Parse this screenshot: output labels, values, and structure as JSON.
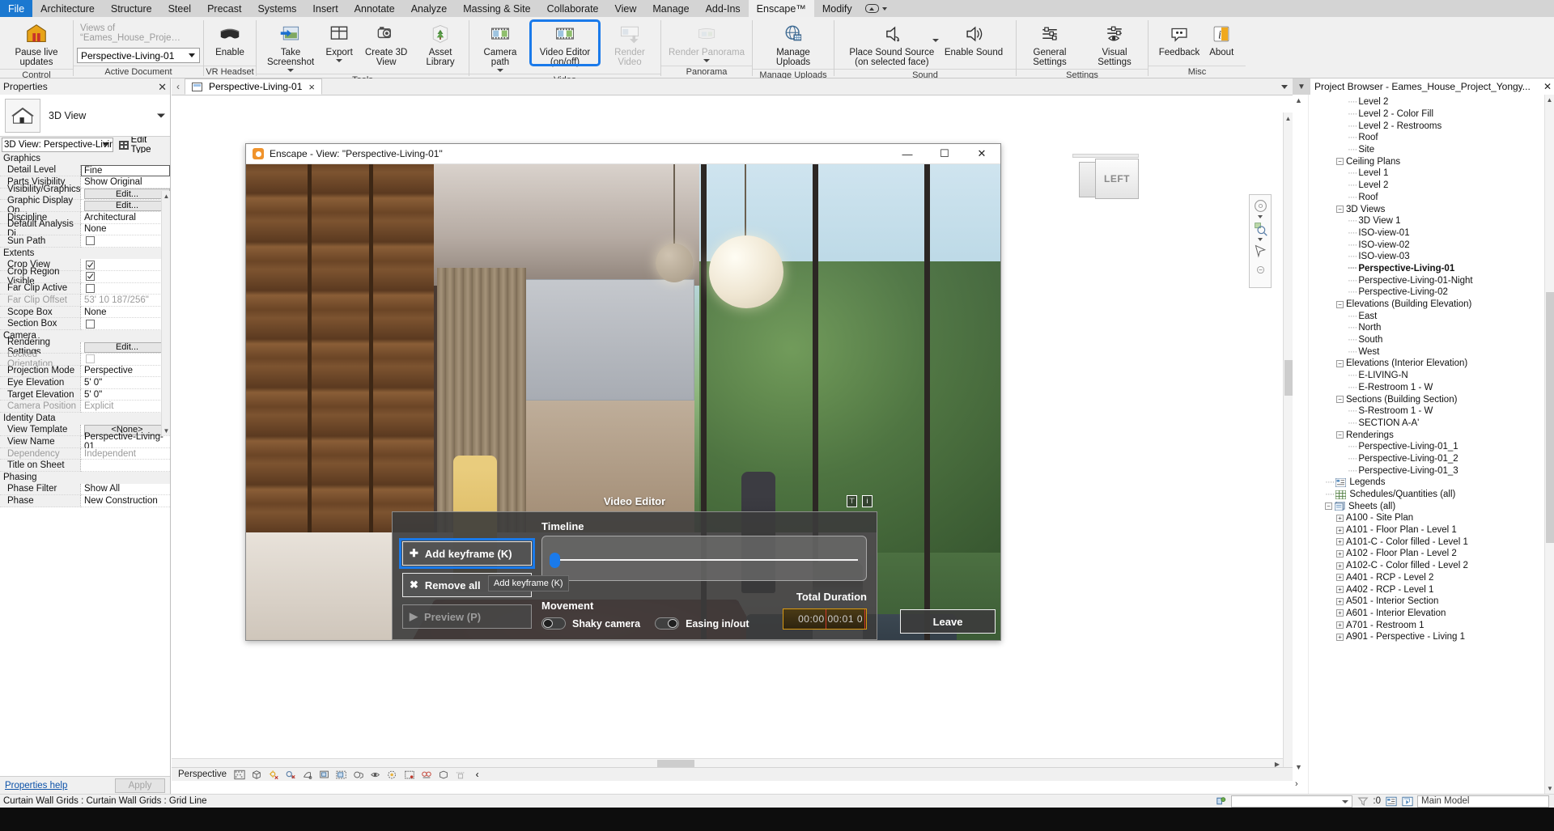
{
  "menu": {
    "file_label": "File",
    "items": [
      "Architecture",
      "Structure",
      "Steel",
      "Precast",
      "Systems",
      "Insert",
      "Annotate",
      "Analyze",
      "Massing & Site",
      "Collaborate",
      "View",
      "Manage",
      "Add-Ins",
      "Enscape™",
      "Modify"
    ],
    "active": "Enscape™"
  },
  "ribbon": {
    "groups": [
      {
        "label": "Control",
        "buttons": [
          {
            "label": "Pause live updates",
            "icon": "pause-live-updates-icon",
            "enabled": true
          }
        ]
      },
      {
        "label": "Active Document",
        "buttons": []
      },
      {
        "label": "VR Headset",
        "buttons": [
          {
            "label": "Enable",
            "icon": "vr-headset-icon",
            "enabled": true
          }
        ]
      },
      {
        "label": "Tools",
        "buttons": [
          {
            "label": "Take Screenshot",
            "icon": "take-screenshot-icon",
            "enabled": true,
            "dropdown": true
          },
          {
            "label": "Export",
            "icon": "export-icon",
            "enabled": true,
            "dropdown": true
          },
          {
            "label": "Create 3D View",
            "icon": "create-3d-view-icon",
            "enabled": true
          },
          {
            "label": "Asset Library",
            "icon": "asset-library-icon",
            "enabled": true
          }
        ]
      },
      {
        "label": "Video",
        "buttons": [
          {
            "label": "Camera path",
            "icon": "camera-path-icon",
            "enabled": true,
            "dropdown": true
          },
          {
            "label": "Video Editor (on/off)",
            "icon": "video-editor-icon",
            "enabled": true,
            "highlighted": true
          },
          {
            "label": "Render Video",
            "icon": "render-video-icon",
            "enabled": false
          }
        ]
      },
      {
        "label": "Panorama",
        "buttons": [
          {
            "label": "Render Panorama",
            "icon": "render-panorama-icon",
            "enabled": false,
            "dropdown": true
          }
        ]
      },
      {
        "label": "Manage Uploads",
        "buttons": [
          {
            "label": "Manage Uploads",
            "icon": "manage-uploads-icon",
            "enabled": true
          }
        ]
      },
      {
        "label": "Sound",
        "buttons": [
          {
            "label": "Place Sound Source\n(on selected face)",
            "icon": "place-sound-source-icon",
            "enabled": true,
            "dropdown": true
          },
          {
            "label": "Enable Sound",
            "icon": "enable-sound-icon",
            "enabled": true
          }
        ]
      },
      {
        "label": "Settings",
        "buttons": [
          {
            "label": "General Settings",
            "icon": "general-settings-icon",
            "enabled": true
          },
          {
            "label": "Visual Settings",
            "icon": "visual-settings-icon",
            "enabled": true
          }
        ]
      },
      {
        "label": "Misc",
        "buttons": [
          {
            "label": "Feedback",
            "icon": "feedback-icon",
            "enabled": true
          },
          {
            "label": "About",
            "icon": "about-icon",
            "enabled": true
          }
        ]
      }
    ],
    "active_document": {
      "caption": "Views of “Eames_House_Proje…",
      "value": "Perspective-Living-01"
    }
  },
  "properties": {
    "title": "Properties",
    "thumb_label": "3D View",
    "type_selector": "3D View: Perspective-Living·",
    "edit_type_label": "Edit Type",
    "sections": [
      {
        "name": "Graphics",
        "rows": [
          {
            "key": "Detail Level",
            "value": "Fine",
            "kind": "text",
            "selected": true
          },
          {
            "key": "Parts Visibility",
            "value": "Show Original",
            "kind": "text"
          },
          {
            "key": "Visibility/Graphics ...",
            "value": "Edit...",
            "kind": "button"
          },
          {
            "key": "Graphic Display Op...",
            "value": "Edit...",
            "kind": "button"
          },
          {
            "key": "Discipline",
            "value": "Architectural",
            "kind": "text"
          },
          {
            "key": "Default Analysis Di...",
            "value": "None",
            "kind": "text"
          },
          {
            "key": "Sun Path",
            "value": "",
            "kind": "checkbox",
            "checked": false
          }
        ]
      },
      {
        "name": "Extents",
        "rows": [
          {
            "key": "Crop View",
            "value": "",
            "kind": "checkbox",
            "checked": true
          },
          {
            "key": "Crop Region Visible",
            "value": "",
            "kind": "checkbox",
            "checked": true
          },
          {
            "key": "Far Clip Active",
            "value": "",
            "kind": "checkbox",
            "checked": false
          },
          {
            "key": "Far Clip Offset",
            "value": "53'  10 187/256\"",
            "kind": "text",
            "dim": true
          },
          {
            "key": "Scope Box",
            "value": "None",
            "kind": "text"
          },
          {
            "key": "Section Box",
            "value": "",
            "kind": "checkbox",
            "checked": false
          }
        ]
      },
      {
        "name": "Camera",
        "rows": [
          {
            "key": "Rendering Settings",
            "value": "Edit...",
            "kind": "button"
          },
          {
            "key": "Locked Orientation",
            "value": "",
            "kind": "checkbox",
            "checked": false,
            "dim": true
          },
          {
            "key": "Projection Mode",
            "value": "Perspective",
            "kind": "text"
          },
          {
            "key": "Eye Elevation",
            "value": "5'  0\"",
            "kind": "text"
          },
          {
            "key": "Target Elevation",
            "value": "5'  0\"",
            "kind": "text"
          },
          {
            "key": "Camera Position",
            "value": "Explicit",
            "kind": "text",
            "dim": true
          }
        ]
      },
      {
        "name": "Identity Data",
        "rows": [
          {
            "key": "View Template",
            "value": "<None>",
            "kind": "button"
          },
          {
            "key": "View Name",
            "value": "Perspective-Living-01",
            "kind": "text"
          },
          {
            "key": "Dependency",
            "value": "Independent",
            "kind": "text",
            "dim": true
          },
          {
            "key": "Title on Sheet",
            "value": "",
            "kind": "text"
          }
        ]
      },
      {
        "name": "Phasing",
        "rows": [
          {
            "key": "Phase Filter",
            "value": "Show All",
            "kind": "text"
          },
          {
            "key": "Phase",
            "value": "New Construction",
            "kind": "text"
          }
        ]
      }
    ],
    "help_link": "Properties help",
    "apply_label": "Apply"
  },
  "document_tab": {
    "label": "Perspective-Living-01",
    "close": "×"
  },
  "viewcube": {
    "face_left": "LEFT"
  },
  "enscape_window": {
    "title": "Enscape - View: \"Perspective-Living-01\"",
    "minimize": "—",
    "maximize": "☐",
    "close": "✕"
  },
  "video_editor": {
    "title": "Video Editor",
    "pin_icon": "pin-icon",
    "info_icon": "info-icon",
    "add_keyframe_label": "Add keyframe (K)",
    "remove_all_label": "Remove all",
    "preview_label": "Preview (P)",
    "timeline_label": "Timeline",
    "movement_label": "Movement",
    "shaky_camera_label": "Shaky camera",
    "shaky_camera_state": "off",
    "easing_label": "Easing in/out",
    "easing_state": "on",
    "total_duration_label": "Total Duration",
    "total_duration_value": "00:00 00:01 0",
    "tooltip": "Add keyframe (K)",
    "leave_label": "Leave",
    "accent_color": "#1a7aea"
  },
  "project_browser": {
    "title": "Project Browser - Eames_House_Project_Yongy...",
    "close": "✕",
    "nodes": [
      {
        "label": "Level 2",
        "depth": 3,
        "toggle": null,
        "icon": null
      },
      {
        "label": "Level 2 - Color Fill",
        "depth": 3,
        "toggle": null,
        "icon": null
      },
      {
        "label": "Level 2 - Restrooms",
        "depth": 3,
        "toggle": null,
        "icon": null
      },
      {
        "label": "Roof",
        "depth": 3,
        "toggle": null,
        "icon": null
      },
      {
        "label": "Site",
        "depth": 3,
        "toggle": null,
        "icon": null
      },
      {
        "label": "Ceiling Plans",
        "depth": 2,
        "toggle": "minus",
        "icon": null
      },
      {
        "label": "Level 1",
        "depth": 3,
        "toggle": null,
        "icon": null
      },
      {
        "label": "Level 2",
        "depth": 3,
        "toggle": null,
        "icon": null
      },
      {
        "label": "Roof",
        "depth": 3,
        "toggle": null,
        "icon": null
      },
      {
        "label": "3D Views",
        "depth": 2,
        "toggle": "minus",
        "icon": null
      },
      {
        "label": "3D View 1",
        "depth": 3,
        "toggle": null,
        "icon": null
      },
      {
        "label": "ISO-view-01",
        "depth": 3,
        "toggle": null,
        "icon": null
      },
      {
        "label": "ISO-view-02",
        "depth": 3,
        "toggle": null,
        "icon": null
      },
      {
        "label": "ISO-view-03",
        "depth": 3,
        "toggle": null,
        "icon": null
      },
      {
        "label": "Perspective-Living-01",
        "depth": 3,
        "toggle": null,
        "icon": null,
        "bold": true
      },
      {
        "label": "Perspective-Living-01-Night",
        "depth": 3,
        "toggle": null,
        "icon": null
      },
      {
        "label": "Perspective-Living-02",
        "depth": 3,
        "toggle": null,
        "icon": null
      },
      {
        "label": "Elevations (Building Elevation)",
        "depth": 2,
        "toggle": "minus",
        "icon": null
      },
      {
        "label": "East",
        "depth": 3,
        "toggle": null,
        "icon": null
      },
      {
        "label": "North",
        "depth": 3,
        "toggle": null,
        "icon": null
      },
      {
        "label": "South",
        "depth": 3,
        "toggle": null,
        "icon": null
      },
      {
        "label": "West",
        "depth": 3,
        "toggle": null,
        "icon": null
      },
      {
        "label": "Elevations (Interior Elevation)",
        "depth": 2,
        "toggle": "minus",
        "icon": null
      },
      {
        "label": "E-LIVING-N",
        "depth": 3,
        "toggle": null,
        "icon": null
      },
      {
        "label": "E-Restroom 1 - W",
        "depth": 3,
        "toggle": null,
        "icon": null
      },
      {
        "label": "Sections (Building Section)",
        "depth": 2,
        "toggle": "minus",
        "icon": null
      },
      {
        "label": "S-Restroom 1 - W",
        "depth": 3,
        "toggle": null,
        "icon": null
      },
      {
        "label": "SECTION A-A'",
        "depth": 3,
        "toggle": null,
        "icon": null
      },
      {
        "label": "Renderings",
        "depth": 2,
        "toggle": "minus",
        "icon": null
      },
      {
        "label": "Perspective-Living-01_1",
        "depth": 3,
        "toggle": null,
        "icon": null
      },
      {
        "label": "Perspective-Living-01_2",
        "depth": 3,
        "toggle": null,
        "icon": null
      },
      {
        "label": "Perspective-Living-01_3",
        "depth": 3,
        "toggle": null,
        "icon": null
      },
      {
        "label": "Legends",
        "depth": 1,
        "toggle": null,
        "icon": "legend-icon"
      },
      {
        "label": "Schedules/Quantities (all)",
        "depth": 1,
        "toggle": null,
        "icon": "schedule-icon"
      },
      {
        "label": "Sheets (all)",
        "depth": 1,
        "toggle": "minus",
        "icon": "sheets-icon"
      },
      {
        "label": "A100 - Site Plan",
        "depth": 2,
        "toggle": "plus",
        "icon": null
      },
      {
        "label": "A101 - Floor Plan - Level 1",
        "depth": 2,
        "toggle": "plus",
        "icon": null
      },
      {
        "label": "A101-C - Color filled - Level 1",
        "depth": 2,
        "toggle": "plus",
        "icon": null
      },
      {
        "label": "A102 - Floor Plan - Level 2",
        "depth": 2,
        "toggle": "plus",
        "icon": null
      },
      {
        "label": "A102-C - Color filled - Level 2",
        "depth": 2,
        "toggle": "plus",
        "icon": null
      },
      {
        "label": "A401 - RCP - Level 2",
        "depth": 2,
        "toggle": "plus",
        "icon": null
      },
      {
        "label": "A402 - RCP - Level 1",
        "depth": 2,
        "toggle": "plus",
        "icon": null
      },
      {
        "label": "A501 - Interior Section",
        "depth": 2,
        "toggle": "plus",
        "icon": null
      },
      {
        "label": "A601 - Interior Elevation",
        "depth": 2,
        "toggle": "plus",
        "icon": null
      },
      {
        "label": "A701 - Restroom 1",
        "depth": 2,
        "toggle": "plus",
        "icon": null
      },
      {
        "label": "A901 - Perspective - Living 1",
        "depth": 2,
        "toggle": "plus",
        "icon": null
      }
    ]
  },
  "view_control_bar": {
    "scale_label": "Perspective",
    "icons": [
      "detail-level-icon",
      "visual-style-icon",
      "sun-path-icon",
      "shadows-icon",
      "rendering-dialog-icon",
      "crop-view-icon",
      "crop-region-icon",
      "lock-3d-view-icon",
      "temporary-hide-isolate-icon",
      "reveal-hidden-icon",
      "analytical-model-icon",
      "highlight-displacement-icon",
      "worksharing-display-icon",
      "constraints-icon"
    ],
    "more": "‹"
  },
  "status_bar": {
    "text": "Curtain Wall Grids : Curtain Wall Grids : Grid Line",
    "filter_count": ":0",
    "model_label": "Main Model",
    "combo_value": ""
  }
}
